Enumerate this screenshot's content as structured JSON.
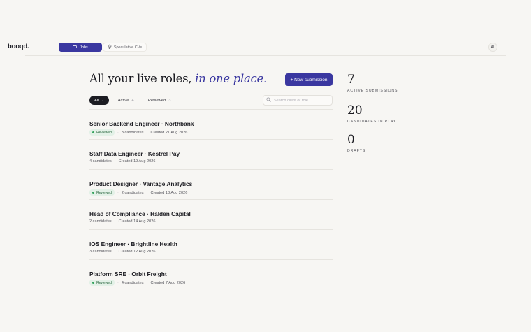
{
  "app": {
    "logo": "booqd."
  },
  "nav": {
    "jobs_label": "Jobs",
    "cvs_label": "Speculative CVs",
    "avatar": "AL"
  },
  "header": {
    "title_plain": "All your live roles, ",
    "title_accent": "in one place.",
    "new_submission_label": "+ New submission"
  },
  "filters": [
    {
      "label": "All",
      "count": "7"
    },
    {
      "label": "Active",
      "count": "4"
    },
    {
      "label": "Reviewed",
      "count": "3"
    }
  ],
  "search": {
    "placeholder": "Search client or role",
    "value": ""
  },
  "roles": [
    {
      "title": "Senior Backend Engineer · Northbank",
      "badge": "Reviewed",
      "candidates": "3 candidates",
      "created": "Created 21 Aug 2026"
    },
    {
      "title": "Staff Data Engineer · Kestrel Pay",
      "badge": "",
      "candidates": "4 candidates",
      "created": "Created 19 Aug 2026"
    },
    {
      "title": "Product Designer · Vantage Analytics",
      "badge": "Reviewed",
      "candidates": "2 candidates",
      "created": "Created 18 Aug 2026"
    },
    {
      "title": "Head of Compliance · Halden Capital",
      "badge": "",
      "candidates": "2 candidates",
      "created": "Created 14 Aug 2026"
    },
    {
      "title": "iOS Engineer · Brightline Health",
      "badge": "",
      "candidates": "3 candidates",
      "created": "Created 12 Aug 2026"
    },
    {
      "title": "Platform SRE · Orbit Freight",
      "badge": "Reviewed",
      "candidates": "4 candidates",
      "created": "Created 7 Aug 2026"
    }
  ],
  "stats": [
    {
      "value": "7",
      "label": "ACTIVE SUBMISSIONS"
    },
    {
      "value": "20",
      "label": "CANDIDATES IN PLAY"
    },
    {
      "value": "0",
      "label": "DRAFTS"
    }
  ],
  "icons": {
    "jobs": "briefcase-icon",
    "cvs": "sparkle-icon",
    "search": "search-icon"
  },
  "colors": {
    "accent": "#3a37a0",
    "reviewed_bg": "#e3f1e7",
    "reviewed_text": "#2e6a43",
    "reviewed_dot": "#35a45d"
  }
}
